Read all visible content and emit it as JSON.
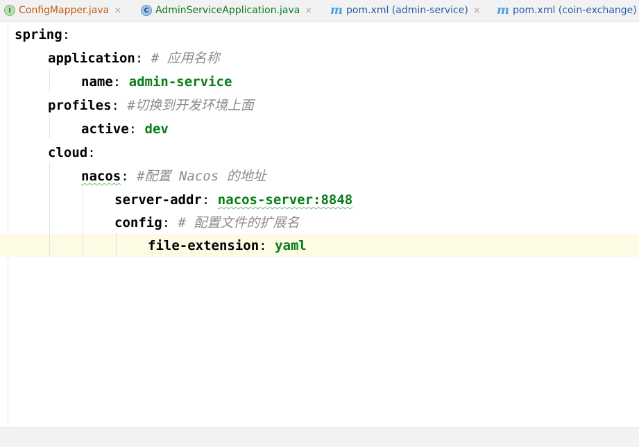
{
  "tabs": [
    {
      "label": "ConfigMapper.java",
      "icon": "interface-icon",
      "icon_glyph": "I",
      "close": "×",
      "color": "#c25a12"
    },
    {
      "label": "AdminServiceApplication.java",
      "icon": "java-class-icon",
      "icon_glyph": "C",
      "close": "×",
      "color": "#0b7a1f"
    },
    {
      "label": "pom.xml (admin-service)",
      "icon": "maven-icon",
      "icon_glyph": "m",
      "close": "×",
      "color": "#2b5aa8"
    },
    {
      "label": "pom.xml (coin-exchange)",
      "icon": "maven-icon",
      "icon_glyph": "m",
      "close": "×",
      "color": "#2b5aa8"
    }
  ],
  "code": {
    "l1": {
      "key": "spring",
      "colon": ":"
    },
    "l2": {
      "key": "application",
      "colon": ":",
      "comment": " # 应用名称"
    },
    "l3": {
      "key": "name",
      "colon": ":",
      "value": "admin-service"
    },
    "l4": {
      "key": "profiles",
      "colon": ":",
      "comment": " #切换到开发环境上面"
    },
    "l5": {
      "key": "active",
      "colon": ":",
      "value": "dev"
    },
    "l6": {
      "key": "cloud",
      "colon": ":"
    },
    "l7": {
      "key": "nacos",
      "colon": ":",
      "comment": " #配置 Nacos 的地址"
    },
    "l8": {
      "key": "server-addr",
      "colon": ":",
      "value": "nacos-server:8848"
    },
    "l9": {
      "key": "config",
      "colon": ":",
      "comment": " # 配置文件的扩展名"
    },
    "l10": {
      "key": "file-extension",
      "colon": ":",
      "value": "yaml"
    }
  },
  "colors": {
    "key": "#000000",
    "value": "#067d17",
    "comment": "#8c8c8c",
    "current_line": "#fdfbe3"
  }
}
